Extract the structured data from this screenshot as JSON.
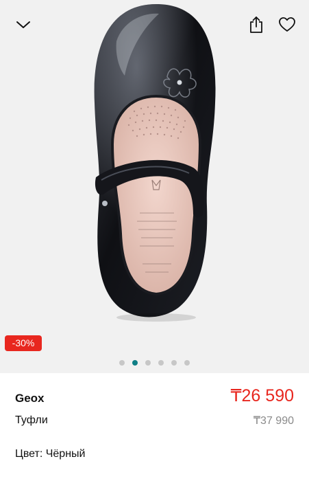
{
  "header": {
    "collapse_icon": "chevron-down-icon",
    "share_icon": "share-icon",
    "favorite_icon": "heart-outline-icon"
  },
  "gallery": {
    "discount_badge": "-30%",
    "image_count": 6,
    "active_index": 1,
    "accent_color": "#0f7f86"
  },
  "product": {
    "brand": "Geox",
    "category": "Туфли",
    "price": "₸26 590",
    "old_price": "₸37 990",
    "color_line": "Цвет: Чёрный",
    "price_color": "#e8271f"
  }
}
